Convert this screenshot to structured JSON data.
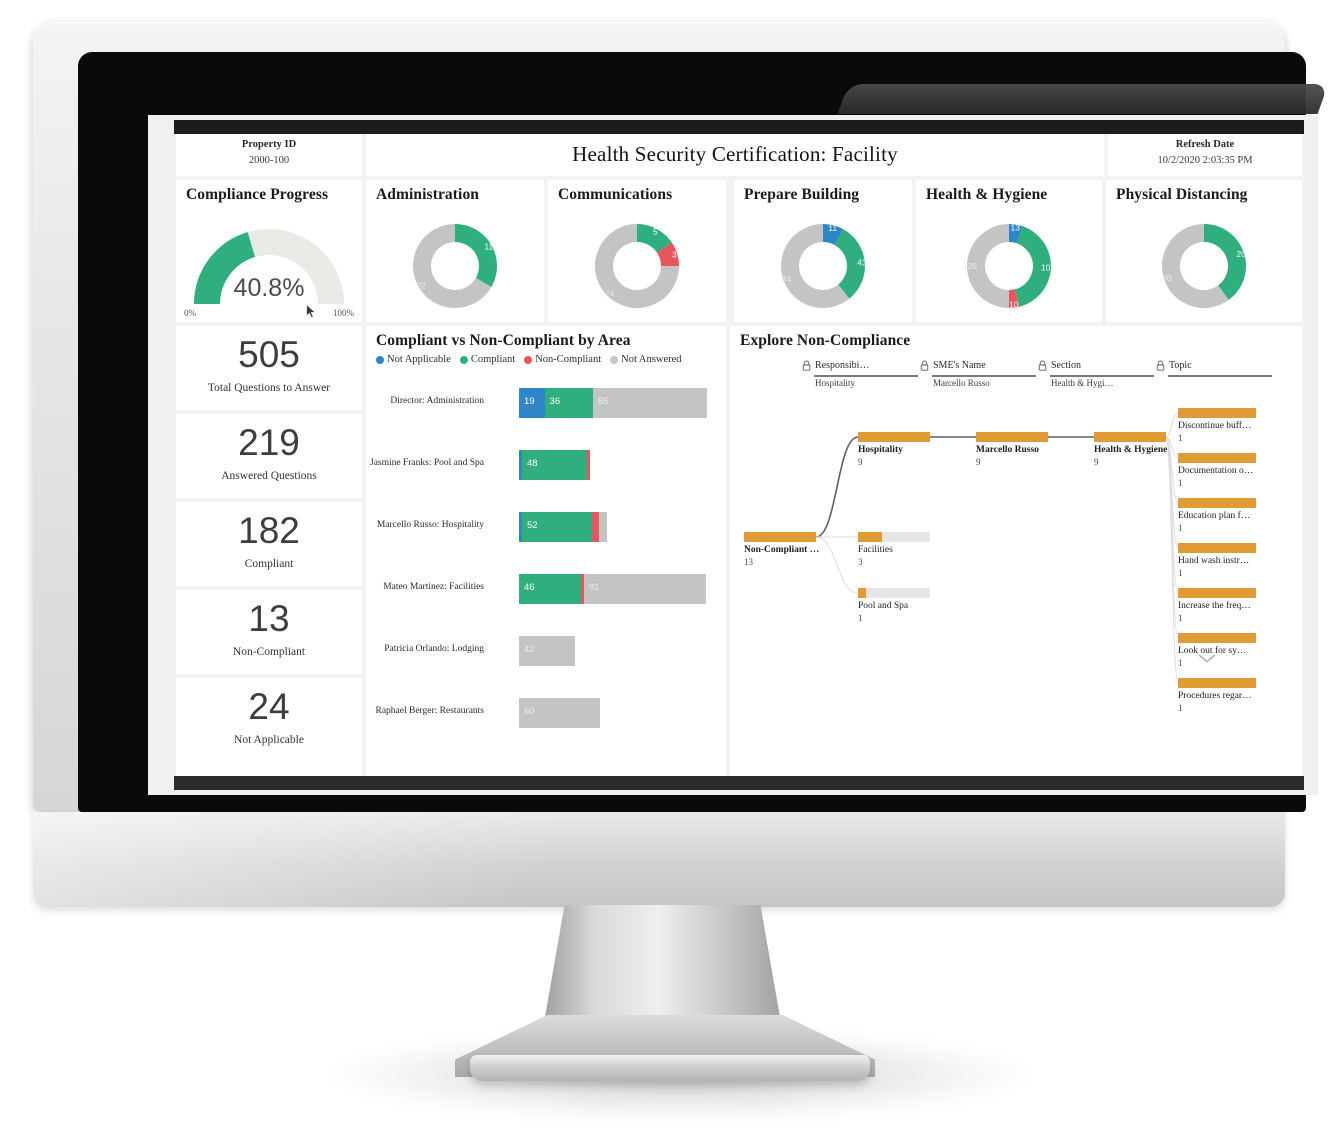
{
  "header": {
    "property_label": "Property ID",
    "property_value": "2000-100",
    "title": "Health Security Certification: Facility",
    "refresh_label": "Refresh Date",
    "refresh_value": "10/2/2020 2:03:35 PM"
  },
  "gauge": {
    "title": "Compliance Progress",
    "percent_label": "40.8%",
    "percent": 40.8,
    "min_label": "0%",
    "max_label": "100%"
  },
  "kpis": [
    {
      "value": "505",
      "label": "Total Questions to Answer"
    },
    {
      "value": "219",
      "label": "Answered Questions"
    },
    {
      "value": "182",
      "label": "Compliant"
    },
    {
      "value": "13",
      "label": "Non-Compliant"
    },
    {
      "value": "24",
      "label": "Not Applicable"
    }
  ],
  "colors": {
    "not_applicable": "#2E86C8",
    "compliant": "#2EAF7D",
    "non_compliant": "#E8555F",
    "not_answered": "#C4C4C4",
    "tree_bar": "#E09B35",
    "tree_bar_bg": "#E6E6E6",
    "gauge_track": "#EAEAE6"
  },
  "chart_data": [
    {
      "type": "pie",
      "title": "Administration",
      "labels": [
        "Compliant",
        "Not Answered"
      ],
      "values": [
        11,
        22
      ],
      "colors": [
        "#2EAF7D",
        "#C4C4C4"
      ]
    },
    {
      "type": "pie",
      "title": "Communications",
      "labels": [
        "Compliant",
        "Non-Compliant",
        "Not Answered"
      ],
      "values": [
        5,
        3,
        24
      ],
      "colors": [
        "#2EAF7D",
        "#E8555F",
        "#C4C4C4"
      ]
    },
    {
      "type": "pie",
      "title": "Prepare Building",
      "labels": [
        "Not Applicable",
        "Compliant",
        "Not Answered"
      ],
      "values": [
        11,
        43,
        84
      ],
      "colors": [
        "#2E86C8",
        "#2EAF7D",
        "#C4C4C4"
      ]
    },
    {
      "type": "pie",
      "title": "Health & Hygiene",
      "labels": [
        "Not Applicable",
        "Compliant",
        "Non-Compliant",
        "Not Answered"
      ],
      "values": [
        13,
        103,
        10,
        126
      ],
      "colors": [
        "#2E86C8",
        "#2EAF7D",
        "#E8555F",
        "#C4C4C4"
      ]
    },
    {
      "type": "pie",
      "title": "Physical Distancing",
      "labels": [
        "Compliant",
        "Not Answered"
      ],
      "values": [
        20,
        30
      ],
      "colors": [
        "#2EAF7D",
        "#C4C4C4"
      ]
    },
    {
      "type": "bar",
      "title": "Compliant vs Non-Compliant by Area",
      "orientation": "horizontal",
      "stacked": true,
      "legend": [
        "Not Applicable",
        "Compliant",
        "Non-Compliant",
        "Not Answered"
      ],
      "legend_colors": [
        "#2E86C8",
        "#2EAF7D",
        "#E8555F",
        "#C4C4C4"
      ],
      "categories": [
        "Director: Administration",
        "Jasmine Franks: Pool and Spa",
        "Marcello Russo: Hospitality",
        "Mateo Martinez: Facilities",
        "Patricia Orlando: Lodging",
        "Raphael Berger: Restaurants"
      ],
      "series": [
        {
          "name": "Not Applicable",
          "values": [
            19,
            1,
            1,
            0,
            0,
            0
          ]
        },
        {
          "name": "Compliant",
          "values": [
            36,
            48,
            52,
            46,
            0,
            0
          ]
        },
        {
          "name": "Non-Compliant",
          "values": [
            0,
            1,
            5,
            2,
            0,
            0
          ]
        },
        {
          "name": "Not Answered",
          "values": [
            85,
            0,
            6,
            91,
            42,
            60
          ]
        }
      ],
      "xmax": 145
    }
  ],
  "bar_chart": {
    "title": "Compliant vs Non-Compliant by Area",
    "legend": [
      {
        "label": "Not Applicable",
        "color": "#2E86C8"
      },
      {
        "label": "Compliant",
        "color": "#2EAF7D"
      },
      {
        "label": "Non-Compliant",
        "color": "#E8555F"
      },
      {
        "label": "Not Answered",
        "color": "#C4C4C4"
      }
    ],
    "rows": [
      {
        "label": "Director: Administration",
        "segments": [
          {
            "c": "#2E86C8",
            "v": 19,
            "t": "19"
          },
          {
            "c": "#2EAF7D",
            "v": 36,
            "t": "36"
          },
          {
            "c": "#C4C4C4",
            "v": 85,
            "t": "85"
          }
        ]
      },
      {
        "label": "Jasmine Franks: Pool and Spa",
        "segments": [
          {
            "c": "#2E86C8",
            "v": 1,
            "t": ""
          },
          {
            "c": "#2EAF7D",
            "v": 48,
            "t": "48"
          },
          {
            "c": "#E8555F",
            "v": 1,
            "t": ""
          }
        ]
      },
      {
        "label": "Marcello Russo: Hospitality",
        "segments": [
          {
            "c": "#2E86C8",
            "v": 1,
            "t": ""
          },
          {
            "c": "#2EAF7D",
            "v": 52,
            "t": "52"
          },
          {
            "c": "#E8555F",
            "v": 5,
            "t": ""
          },
          {
            "c": "#C4C4C4",
            "v": 6,
            "t": ""
          }
        ]
      },
      {
        "label": "Mateo Martinez: Facilities",
        "segments": [
          {
            "c": "#2EAF7D",
            "v": 46,
            "t": "46"
          },
          {
            "c": "#E8555F",
            "v": 2,
            "t": ""
          },
          {
            "c": "#C4C4C4",
            "v": 91,
            "t": "91"
          }
        ]
      },
      {
        "label": "Patricia Orlando: Lodging",
        "segments": [
          {
            "c": "#C4C4C4",
            "v": 42,
            "t": "42"
          }
        ]
      },
      {
        "label": "Raphael Berger: Restaurants",
        "segments": [
          {
            "c": "#C4C4C4",
            "v": 60,
            "t": "60"
          }
        ]
      }
    ]
  },
  "tree": {
    "title": "Explore Non-Compliance",
    "columns": [
      {
        "name": "Responsibi…",
        "value": "Hospitality"
      },
      {
        "name": "SME's Name",
        "value": "Marcello Russo"
      },
      {
        "name": "Section",
        "value": "Health & Hygi…"
      },
      {
        "name": "Topic",
        "value": ""
      }
    ],
    "root": {
      "name": "Non-Compliant …",
      "value": "13"
    },
    "level1": [
      {
        "name": "Hospitality",
        "value": "9",
        "fill": 1.0,
        "selected": true
      },
      {
        "name": "Facilities",
        "value": "3",
        "fill": 0.33,
        "selected": false
      },
      {
        "name": "Pool and Spa",
        "value": "1",
        "fill": 0.11,
        "selected": false
      }
    ],
    "level2": [
      {
        "name": "Marcello Russo",
        "value": "9",
        "fill": 1.0,
        "selected": true
      }
    ],
    "level3": [
      {
        "name": "Health & Hygiene",
        "value": "9",
        "fill": 1.0,
        "selected": true
      }
    ],
    "level4": [
      {
        "name": "Discontinue buff…",
        "value": "1",
        "fill": 1.0
      },
      {
        "name": "Documentation o…",
        "value": "1",
        "fill": 1.0
      },
      {
        "name": "Education plan f…",
        "value": "1",
        "fill": 1.0
      },
      {
        "name": "Hand wash instr…",
        "value": "1",
        "fill": 1.0
      },
      {
        "name": "Increase the freq…",
        "value": "1",
        "fill": 1.0
      },
      {
        "name": "Look out for sy…",
        "value": "1",
        "fill": 1.0
      },
      {
        "name": "Procedures regar…",
        "value": "1",
        "fill": 1.0
      }
    ]
  }
}
